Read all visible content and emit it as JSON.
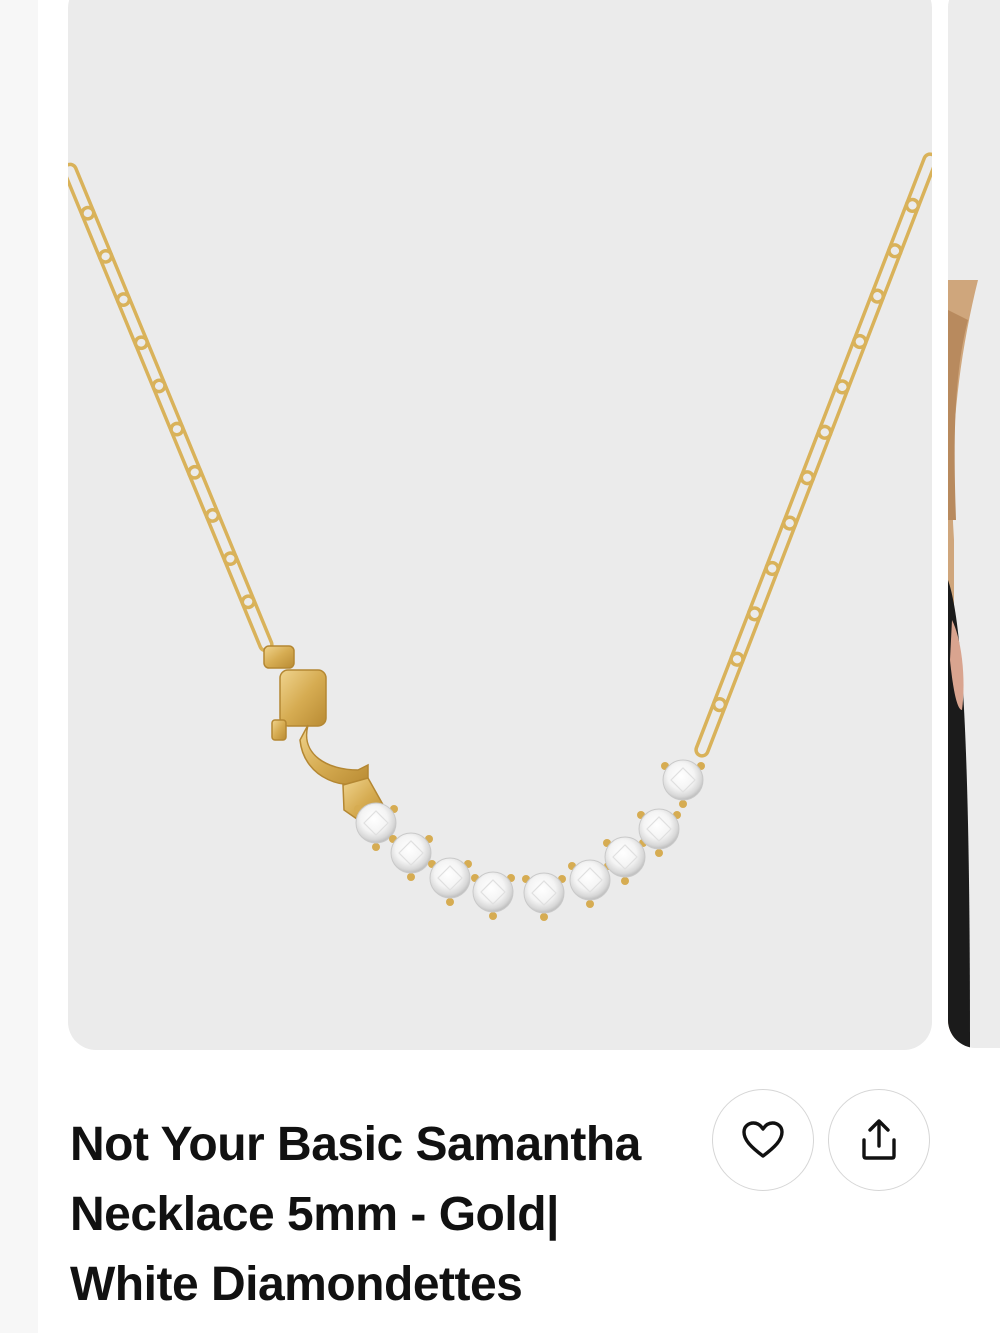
{
  "product": {
    "title_line1": "Not Your Basic Samantha",
    "title_line2": "Necklace 5mm - Gold|",
    "title_line3": "White Diamondettes",
    "image_subject": "gold paperclip chain necklace with white round stones"
  },
  "actions": {
    "wishlist_icon": "heart-icon",
    "share_icon": "share-icon"
  },
  "colors": {
    "image_background": "#ebebeb",
    "gold": "#d9b25a",
    "title_text": "#111111",
    "button_border": "#d6d6d6"
  }
}
